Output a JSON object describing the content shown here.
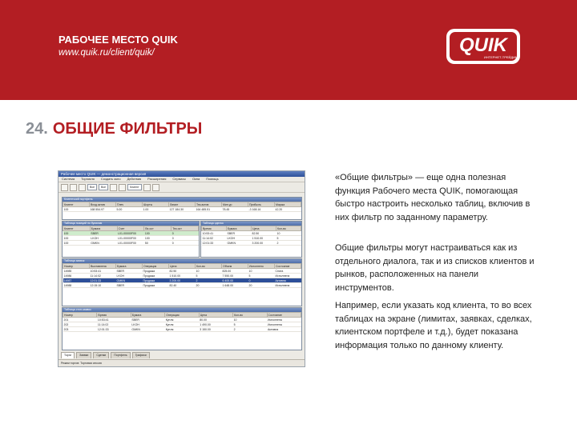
{
  "header": {
    "title": "РАБОЧЕЕ МЕСТО QUIK",
    "url": "www.quik.ru/client/quik/",
    "bg_color": "#b31e23"
  },
  "logo": {
    "text": "QUIK",
    "tagline": "ИНТЕРНЕТ-ТРЕЙДИНГ"
  },
  "slide": {
    "number": "24.",
    "title": "ОБЩИЕ ФИЛЬТРЫ"
  },
  "paragraphs": [
    "«Общие фильтры» — еще одна полезная функция Рабочего места QUIK, помогающая быстро настроить несколько таблиц, включив в них фильтр по заданному параметру.",
    "Общие фильтры могут настраиваться как из отдельного диалога, так и из списков клиентов и рынков, расположенных на панели инструментов.",
    "Например, если указать код клиента, то во всех таблицах на экране (лимитах, заявках, сделках, клиентском портфеле и т.д.), будет показана информация только по данному клиенту."
  ],
  "screenshot": {
    "titlebar": "Рабочее место QUIK — демонстрационная версия",
    "menu": [
      "Система",
      "Торговля",
      "Создать окно",
      "Действия",
      "Расширения",
      "Сервисы",
      "Окна",
      "Помощь"
    ],
    "toolbar_fields": [
      "Все",
      "Все",
      "Клиент"
    ],
    "win1": {
      "title": "Клиентский портфель",
      "columns": [
        "Клиент",
        "Вход.актив",
        "Плеч",
        "Шорты",
        "Лимит",
        "Тек.актив",
        "Мин.ур",
        "Прибыль",
        "Маржа"
      ],
      "rows": [
        [
          "100",
          "168 554.97",
          "5.00",
          "1.00",
          "127 184.30",
          "164 485.51",
          "78.45",
          "-3 168.16",
          "42.20"
        ]
      ]
    },
    "win2": {
      "title": "Таблица позиций по бумагам",
      "columns": [
        "Клиент",
        "Бумага",
        "Счет",
        "Вх.ост",
        "Тек.ост"
      ],
      "rows": [
        [
          "100",
          "SBER",
          "L01-00000F00",
          "100",
          "0"
        ],
        [
          "100",
          "LKOH",
          "L01-00000F00",
          "100",
          "0"
        ],
        [
          "100",
          "GMKN",
          "L01-00000F00",
          "50",
          "0"
        ]
      ]
    },
    "win3": {
      "title": "Таблица сделок",
      "columns": [
        "Время",
        "Бумага",
        "Цена",
        "Кол-во"
      ],
      "rows": [
        [
          "10:53:41",
          "SBER",
          "82.50",
          "10"
        ],
        [
          "11:14:02",
          "LKOH",
          "1 510.00",
          "5"
        ],
        [
          "12:01:33",
          "GMKN",
          "3 200.00",
          "2"
        ]
      ]
    },
    "win4": {
      "title": "Таблица заявок",
      "columns": [
        "Номер",
        "Выставлена",
        "Бумага",
        "Операция",
        "Цена",
        "Кол-во",
        "Объем",
        "Исполнено",
        "Состояние"
      ],
      "rows": [
        [
          "14985",
          "10:53:41",
          "SBER",
          "Продажа",
          "82.50",
          "10",
          "825.00",
          "10",
          "Снята"
        ],
        [
          "14986",
          "11:14:02",
          "LKOH",
          "Продажа",
          "1 510.00",
          "5",
          "7 550.00",
          "5",
          "Исполнена"
        ],
        [
          "14987",
          "12:01:33",
          "GMKN",
          "Продажа",
          "3 200.00",
          "2",
          "6 400.00",
          "0",
          "Активна"
        ],
        [
          "14988",
          "12:15:10",
          "SBER",
          "Продажа",
          "82.40",
          "20",
          "1 648.00",
          "20",
          "Исполнена"
        ]
      ]
    },
    "win5": {
      "title": "Таблица стоп-заявок",
      "columns": [
        "Номер",
        "Время",
        "Бумага",
        "Операция",
        "Цена",
        "Кол-во",
        "Состояние"
      ],
      "rows": [
        [
          "201",
          "10:53:41",
          "SBER",
          "Купля",
          "80.00",
          "10",
          "Исполнена"
        ],
        [
          "202",
          "11:14:02",
          "LKOH",
          "Купля",
          "1 490.00",
          "5",
          "Исполнена"
        ],
        [
          "203",
          "12:01:33",
          "GMKN",
          "Купля",
          "3 150.00",
          "2",
          "Активна"
        ]
      ]
    },
    "tabs": [
      "Торги",
      "Заявки",
      "Сделки",
      "Портфель",
      "Графики"
    ],
    "status": "Режим торгов: Торговая сессия"
  }
}
